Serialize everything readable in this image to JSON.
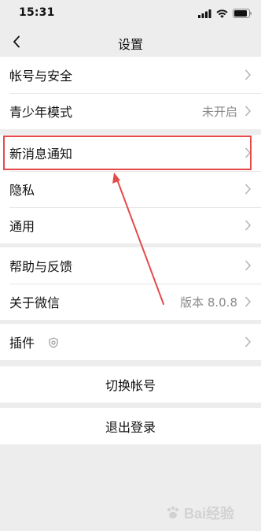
{
  "status_bar": {
    "time": "15:31"
  },
  "navbar": {
    "title": "设置"
  },
  "groups": [
    {
      "rows": [
        {
          "label": "帐号与安全",
          "value": ""
        },
        {
          "label": "青少年模式",
          "value": "未开启"
        }
      ]
    },
    {
      "rows": [
        {
          "label": "新消息通知",
          "value": ""
        },
        {
          "label": "隐私",
          "value": ""
        },
        {
          "label": "通用",
          "value": ""
        }
      ]
    },
    {
      "rows": [
        {
          "label": "帮助与反馈",
          "value": ""
        },
        {
          "label": "关于微信",
          "value": "版本 8.0.8"
        }
      ]
    },
    {
      "rows": [
        {
          "label": "插件",
          "value": ""
        }
      ]
    }
  ],
  "actions": {
    "switch_account": "切换帐号",
    "logout": "退出登录"
  },
  "annotation": {
    "color": "#e54a4a"
  },
  "watermark": {
    "text": "Bai经验"
  },
  "icons": [
    "chevron-left-icon",
    "chevron-right-icon",
    "plugin-shield-icon",
    "signal-icon",
    "wifi-icon",
    "battery-icon"
  ]
}
